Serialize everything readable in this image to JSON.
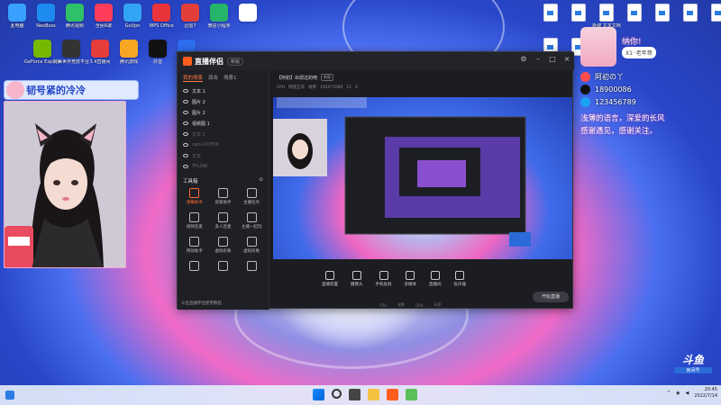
{
  "desktop_left_row1": [
    {
      "label": "此电脑",
      "color": "#38a0ff"
    },
    {
      "label": "NeoBoss",
      "color": "#1d8bf0"
    },
    {
      "label": "腾讯视频",
      "color": "#2fc06a"
    },
    {
      "label": "全民K歌",
      "color": "#ff3d5a"
    },
    {
      "label": "GoVpn",
      "color": "#33a3f5"
    },
    {
      "label": "WPS Office",
      "color": "#e8343a"
    },
    {
      "label": "迅雷7",
      "color": "#e23f3a"
    },
    {
      "label": "微信小程序",
      "color": "#26b36a"
    },
    {
      "label": "",
      "color": "#ffffff"
    }
  ],
  "desktop_left_row2": [
    {
      "label": "GeForce Experience",
      "color": "#76b900"
    },
    {
      "label": "完美世界竞技平台",
      "color": "#333333"
    },
    {
      "label": "3.4直播间",
      "color": "#e63c3c"
    },
    {
      "label": "腾讯游戏",
      "color": "#f5a623"
    },
    {
      "label": "抖音",
      "color": "#111111"
    },
    {
      "label": "",
      "color": "#2d6ff2"
    }
  ],
  "desktop_right_files": [
    "",
    "",
    "新建 文本文档",
    "",
    "",
    "",
    "",
    "",
    "",
    ""
  ],
  "name_tag": "韧号紧的冷冷",
  "obs": {
    "title": "直播伴侣",
    "version": "新版",
    "tabs": [
      "我的场景",
      "双击",
      "场景1"
    ],
    "sources": [
      {
        "label": "文本 1",
        "dim": false
      },
      {
        "label": "图片 2",
        "dim": false
      },
      {
        "label": "图片 2",
        "dim": false
      },
      {
        "label": "视频图 1",
        "dim": false
      },
      {
        "label": "文本 1",
        "dim": true
      },
      {
        "label": "cam-VCM36",
        "dim": true
      },
      {
        "label": "文本",
        "dim": true
      },
      {
        "label": "TPLINK",
        "dim": true
      }
    ],
    "tools_header": "工具箱",
    "tools": [
      {
        "label": "弹幕助手",
        "active": true
      },
      {
        "label": "房管助手",
        "active": false
      },
      {
        "label": "主播任务",
        "active": false
      },
      {
        "label": "视频连麦",
        "active": false
      },
      {
        "label": "多人连麦",
        "active": false
      },
      {
        "label": "主播一起玩",
        "active": false
      },
      {
        "label": "特效助手",
        "active": false
      },
      {
        "label": "虚拟形象",
        "active": false
      },
      {
        "label": "虚拟形象",
        "active": false
      },
      {
        "label": "",
        "active": false
      },
      {
        "label": "",
        "active": false
      },
      {
        "label": "",
        "active": false
      }
    ],
    "note": "斗鱼直播伴侣使用教程",
    "room_title": "【阿初】出现过的吧",
    "room_badge": "新版",
    "room_stats": [
      "CPU",
      "网速正常",
      "帧率",
      "1920*1080",
      "11",
      "0"
    ],
    "controls": [
      "直播装置",
      "摄像头",
      "手机投屏",
      "多媒体",
      "直播间",
      "投声器"
    ],
    "go_live": "开始直播",
    "status": [
      "CPU",
      "帧数",
      "GPU",
      "码率"
    ]
  },
  "rp": {
    "tag": "纳你!",
    "pill": "X1 ·老年哥",
    "rows": [
      {
        "text": "阿初の丫",
        "color": "#ff4d4d"
      },
      {
        "text": "18900086",
        "color": "#111111"
      },
      {
        "text": "123456789",
        "color": "#1da1f2"
      }
    ],
    "quote1": "浅薄的语言，深爱的长风",
    "quote2": "感谢遇见，感谢关注。"
  },
  "taskbar": {
    "time": "20:45",
    "date": "2022/7/14"
  },
  "douyu": {
    "logo": "斗鱼",
    "room": "房间号"
  }
}
